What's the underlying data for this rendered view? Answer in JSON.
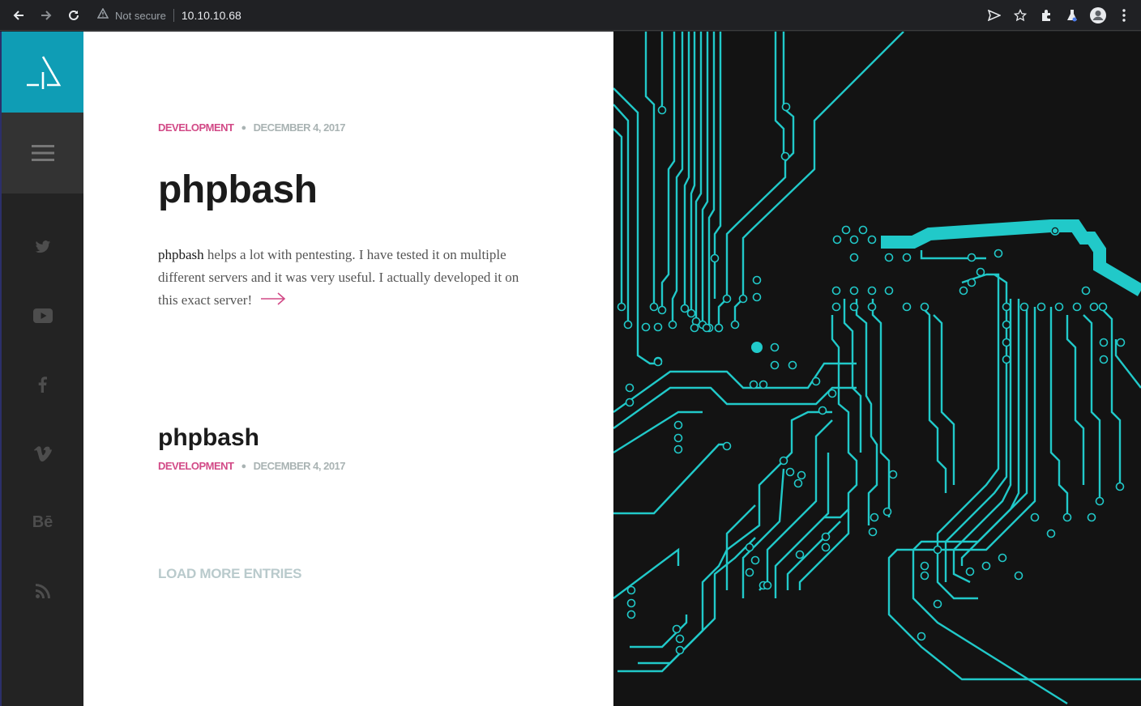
{
  "browser": {
    "security_label": "Not secure",
    "url": "10.10.10.68"
  },
  "sidebar": {
    "social_items": [
      {
        "icon": "twitter-icon"
      },
      {
        "icon": "youtube-icon"
      },
      {
        "icon": "facebook-icon"
      },
      {
        "icon": "vimeo-icon",
        "label": "v"
      },
      {
        "icon": "behance-icon",
        "label": "Bē"
      },
      {
        "icon": "rss-icon"
      }
    ],
    "colors": {
      "logo_bg": "#0f9db5",
      "menu_bg": "#333333",
      "bg": "#232323"
    }
  },
  "post": {
    "category": "DEVELOPMENT",
    "date": "DECEMBER 4, 2017",
    "title": "phpbash",
    "excerpt_lead": "phpbash",
    "excerpt_rest": " helps a lot with pentesting. I have tested it on multiple different servers and it was very useful. I actually developed it on this exact server!"
  },
  "post2": {
    "title": "phpbash",
    "category": "DEVELOPMENT",
    "date": "DECEMBER 4, 2017"
  },
  "load_more": "LOAD MORE ENTRIES",
  "colors": {
    "accent": "#d24a87",
    "circuit": "#21c9c9",
    "muted": "#a9b3b3"
  }
}
